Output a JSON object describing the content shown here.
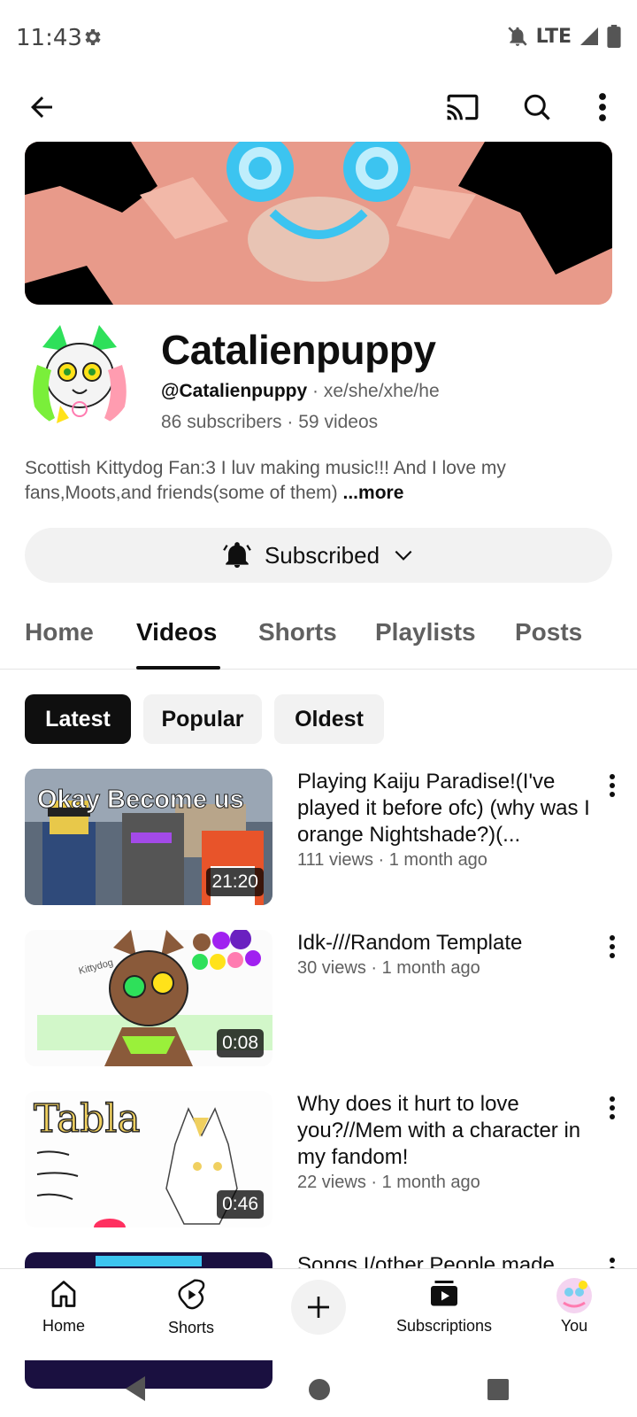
{
  "status_bar": {
    "time": "11:43",
    "network": "LTE",
    "icons": [
      "gear-icon",
      "notifications-off-icon",
      "signal-icon",
      "battery-icon"
    ]
  },
  "app_bar": {
    "icons": [
      "back-arrow-icon",
      "cast-icon",
      "search-icon",
      "more-vert-icon"
    ]
  },
  "channel": {
    "name": "Catalienpuppy",
    "handle": "@Catalienpuppy",
    "pronouns": "xe/she/xhe/he",
    "subscribers": "86 subscribers",
    "videos_count": "59 videos",
    "separator": "·",
    "description": "Scottish Kittydog Fan:3 I luv making music!!! And I love my fans,Moots,and friends(some of them)",
    "more_label": "...more",
    "subscribe_label": "Subscribed"
  },
  "tabs": [
    {
      "label": "Home",
      "active": false
    },
    {
      "label": "Videos",
      "active": true
    },
    {
      "label": "Shorts",
      "active": false
    },
    {
      "label": "Playlists",
      "active": false
    },
    {
      "label": "Posts",
      "active": false
    }
  ],
  "chips": [
    {
      "label": "Latest",
      "active": true
    },
    {
      "label": "Popular",
      "active": false
    },
    {
      "label": "Oldest",
      "active": false
    }
  ],
  "videos": [
    {
      "title": "Playing Kaiju Paradise!(I've played it before ofc) (why was I orange Nightshade?)(...",
      "meta": "111 views · 1 month ago",
      "duration": "21:20",
      "thumb_text": "Okay  Become us"
    },
    {
      "title": "Idk-///Random Template",
      "meta": "30 views · 1 month ago",
      "duration": "0:08",
      "thumb_text": "Kittydog"
    },
    {
      "title": "Why does it hurt to love you?//Mem with a character in my fandom!",
      "meta": "22 views · 1 month ago",
      "duration": "0:46",
      "thumb_text": "Tabla"
    },
    {
      "title": "Songs I/other People made",
      "meta": "",
      "duration": "",
      "thumb_text": ""
    }
  ],
  "bottom_nav": [
    {
      "label": "Home",
      "icon": "home-icon"
    },
    {
      "label": "Shorts",
      "icon": "shorts-icon"
    },
    {
      "label": "",
      "icon": "create-plus-icon"
    },
    {
      "label": "Subscriptions",
      "icon": "subscriptions-icon"
    },
    {
      "label": "You",
      "icon": "you-avatar"
    }
  ],
  "colors": {
    "text_primary": "#0f0f0f",
    "text_secondary": "#606060",
    "chip_bg": "#f2f2f2",
    "banner_pink": "#e89a8a",
    "banner_eye_blue": "#3cc4f0"
  }
}
